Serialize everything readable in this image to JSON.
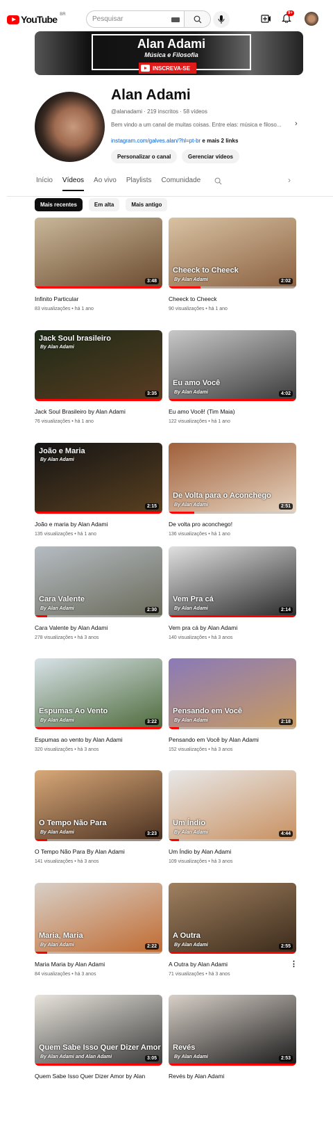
{
  "header": {
    "logo": "YouTube",
    "country": "BR",
    "search_placeholder": "Pesquisar",
    "notification_badge": "9+"
  },
  "banner": {
    "title": "Alan Adami",
    "subtitle": "Música e Filosofia",
    "subscribe": "INSCREVA-SE"
  },
  "channel": {
    "name": "Alan Adami",
    "meta": "@alanadami · 219 inscritos · 58 vídeos",
    "description": "Bem vindo a um canal de muitas coisas. Entre elas: música e filoso...",
    "link": "instagram.com/galves.alan/?hl=pt-br",
    "link_more": " e mais 2 links",
    "customize": "Personalizar o canal",
    "manage": "Gerenciar vídeos"
  },
  "tabs": [
    {
      "label": "Início"
    },
    {
      "label": "Vídeos"
    },
    {
      "label": "Ao vivo"
    },
    {
      "label": "Playlists"
    },
    {
      "label": "Comunidade"
    }
  ],
  "chips": [
    {
      "label": "Mais recentes"
    },
    {
      "label": "Em alta"
    },
    {
      "label": "Mais antigo"
    }
  ],
  "videos": [
    {
      "title": "Infinito Particular",
      "meta": "83 visualizações • há 1 ano",
      "duration": "3:48",
      "overlay": "",
      "overlay_by": "",
      "progress": 1.0,
      "colors": [
        "#c9b79a",
        "#6b4a2e"
      ]
    },
    {
      "title": "Cheeck to Cheeck",
      "meta": "90 visualizações • há 1 ano",
      "duration": "2:02",
      "overlay": "Cheeck to Cheeck",
      "overlay_by": "By Alan Adami",
      "progress": 0.25,
      "colors": [
        "#d8c2a2",
        "#8a6040"
      ]
    },
    {
      "title": "Jack Soul Brasileiro by Alan Adami",
      "meta": "76 visualizações • há 1 ano",
      "duration": "3:35",
      "overlay": "Jack Soul brasileiro",
      "overlay_by": "By Alan Adami",
      "overlay_top": true,
      "progress": 1.0,
      "colors": [
        "#1d2a16",
        "#5a3c22"
      ]
    },
    {
      "title": "Eu amo Você! (Tim Maia)",
      "meta": "122 visualizações • há 1 ano",
      "duration": "4:02",
      "overlay": "Eu amo Você",
      "overlay_by": "By Alan Adami",
      "progress": 1.0,
      "colors": [
        "#c8c8c8",
        "#3a3a3a"
      ]
    },
    {
      "title": "João e maria by Alan Adami",
      "meta": "135 visualizações • há 1 ano",
      "duration": "2:15",
      "overlay": "João e Maria",
      "overlay_by": "By Alan Adami",
      "overlay_top": true,
      "progress": 1.0,
      "colors": [
        "#141414",
        "#5a4020"
      ]
    },
    {
      "title": "De volta pro aconchego!",
      "meta": "136 visualizações • há 1 ano",
      "duration": "2:51",
      "overlay": "De Volta para o Aconchego",
      "overlay_by": "By Alan Adami",
      "progress": 0.2,
      "colors": [
        "#a0603a",
        "#e6d4c0"
      ]
    },
    {
      "title": "Cara Valente by Alan Adami",
      "meta": "278 visualizações • há 3 anos",
      "duration": "2:30",
      "overlay": "Cara Valente",
      "overlay_by": "By Alan Adami",
      "progress": 0.1,
      "colors": [
        "#b5bcc2",
        "#6a6a5a"
      ]
    },
    {
      "title": "Vem pra cá by Alan Adami",
      "meta": "140 visualizações • há 3 anos",
      "duration": "2:14",
      "overlay": "Vem Pra cá",
      "overlay_by": "By Alan Adami",
      "progress": 1.0,
      "colors": [
        "#e0e0e0",
        "#2a2a2a"
      ]
    },
    {
      "title": "Espumas ao vento by Alan Adami",
      "meta": "320 visualizações • há 3 anos",
      "duration": "3:22",
      "overlay": "Espumas Ao Vento",
      "overlay_by": "By Alan Adami",
      "progress": 1.0,
      "colors": [
        "#d8e2e8",
        "#4d6a3a"
      ]
    },
    {
      "title": "Pensando em Você by Alan Adami",
      "meta": "152 visualizações • há 3 anos",
      "duration": "2:18",
      "overlay": "Pensando em Você",
      "overlay_by": "By Alan Adami",
      "progress": 0.08,
      "colors": [
        "#8a7ab8",
        "#c89a60"
      ]
    },
    {
      "title": "O Tempo Não Para By Alan Adami",
      "meta": "141 visualizações • há 3 anos",
      "duration": "3:23",
      "overlay": "O Tempo Não Para",
      "overlay_by": "By Alan Adami",
      "progress": 0.1,
      "colors": [
        "#d8a878",
        "#4a3020"
      ]
    },
    {
      "title": "Um Índio by Alan Adami",
      "meta": "109 visualizações • há 3 anos",
      "duration": "4:44",
      "overlay": "Um Índio",
      "overlay_by": "By Alan Adami",
      "progress": 0.08,
      "colors": [
        "#e8e8e8",
        "#c89060"
      ]
    },
    {
      "title": "Maria Maria by Alan Adami",
      "meta": "84 visualizações • há 3 anos",
      "duration": "2:22",
      "overlay": "Maria, Maria",
      "overlay_by": "By Alan Adami",
      "progress": 0.1,
      "colors": [
        "#d8d0c8",
        "#c06a30"
      ]
    },
    {
      "title": "A Outra by Alan Adami",
      "meta": "71 visualizações • há 3 anos",
      "duration": "2:55",
      "overlay": "A Outra",
      "overlay_by": "By Alan Adami",
      "progress": 1.0,
      "colors": [
        "#a08060",
        "#3a2a1a"
      ],
      "menu": "⋮"
    },
    {
      "title": "Quem Sabe Isso Quer Dizer Amor by Alan",
      "meta": "",
      "duration": "3:05",
      "overlay": "Quem Sabe Isso Quer Dizer Amor",
      "overlay_by": "By Alan Adami and Alan Adami",
      "progress": 1.0,
      "colors": [
        "#e8e4dc",
        "#3a3a3a"
      ]
    },
    {
      "title": "Revés by Alan Adami",
      "meta": "",
      "duration": "2:53",
      "overlay": "Revés",
      "overlay_by": "By Alan Adami",
      "progress": 1.0,
      "colors": [
        "#d8d0c8",
        "#1a1a1a"
      ]
    }
  ]
}
